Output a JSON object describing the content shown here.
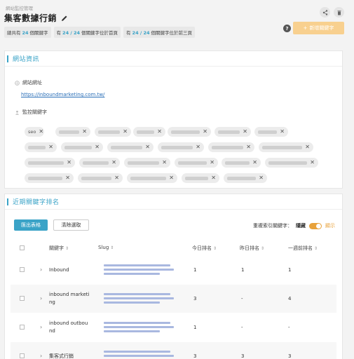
{
  "breadcrumb": "網站監控管理",
  "title": "集客數據行銷",
  "stats": [
    {
      "prefix": "總共有",
      "value": "24",
      "suffix": "個關鍵字"
    },
    {
      "prefix": "有",
      "value": "24 / 24",
      "suffix": "個關鍵字位於首頁"
    },
    {
      "prefix": "有",
      "value": "24 / 24",
      "suffix": "個關鍵字位於前三頁"
    }
  ],
  "add_button": "新增關鍵字",
  "site_card": {
    "heading": "網站資訊",
    "url_label": "網站網址",
    "url": "https://inboundmarketing.com.tw/",
    "keywords_label": "監控關鍵字",
    "visible_tag": "seo"
  },
  "rank_card": {
    "heading": "近期關鍵字排名",
    "export_label": "匯出表格",
    "clear_label": "清除選取",
    "dup_label": "重複索引關鍵字：",
    "hide_label": "隱藏",
    "show_label": "顯示",
    "columns": [
      "關鍵字",
      "Slug",
      "今日排名",
      "昨日排名",
      "一週前排名"
    ],
    "rows": [
      {
        "keyword": "Inbound",
        "today": "1",
        "yesterday": "1",
        "week": "1"
      },
      {
        "keyword": "inbound marketi\nng",
        "today": "3",
        "yesterday": "-",
        "week": "4"
      },
      {
        "keyword": "inbound outbou\nnd",
        "today": "1",
        "yesterday": "-",
        "week": "-"
      },
      {
        "keyword": "集客式行銷",
        "today": "3",
        "yesterday": "3",
        "week": "3"
      }
    ]
  },
  "colors": {
    "accent": "#3aa3c7",
    "orange": "#e8a23b",
    "add_button": "#f8d08f"
  },
  "icons": [
    "pencil-icon",
    "share-icon",
    "trash-icon",
    "help-icon",
    "plus-icon",
    "globe-icon",
    "user-icon",
    "close-icon",
    "chevron-right-icon",
    "sort-icon"
  ]
}
